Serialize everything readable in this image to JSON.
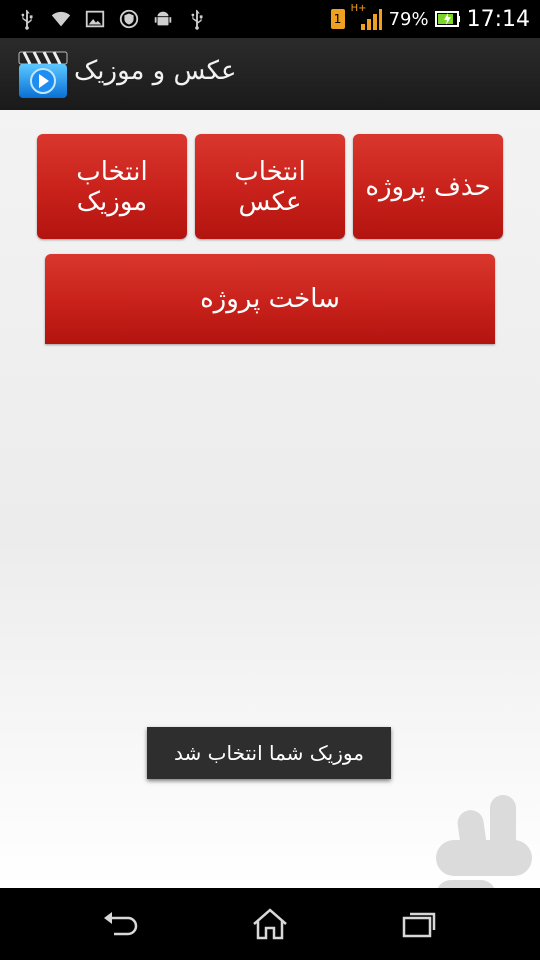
{
  "status_bar": {
    "battery_percent": "79%",
    "time": "17:14",
    "sim_badge": "1",
    "network_label": "H+",
    "icons": [
      "usb-icon",
      "wifi-icon",
      "gallery-icon",
      "shield-icon",
      "android-icon",
      "usb-icon"
    ]
  },
  "action_bar": {
    "title": "عکس و موزیک",
    "icon": "clapperboard-play-icon"
  },
  "buttons": {
    "select_music": "انتخاب\nموزیک",
    "select_photo": "انتخاب\nعکس",
    "delete_project": "حذف پروژه",
    "build_project": "ساخت پروژه"
  },
  "toast": {
    "message": "موزیک شما انتخاب شد"
  },
  "nav_bar": {
    "icons": [
      "back-icon",
      "home-icon",
      "recents-icon"
    ]
  },
  "colors": {
    "button_red": "#c8211b",
    "toast_bg": "#2e2e2e",
    "action_bar_bg": "#222222"
  }
}
